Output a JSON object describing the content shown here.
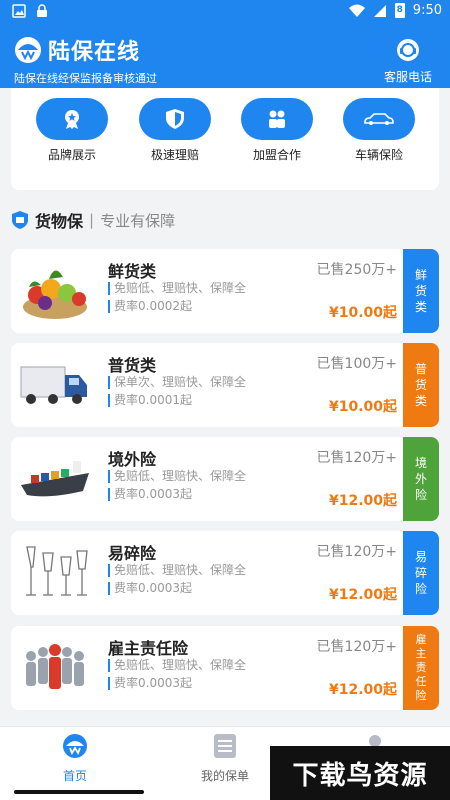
{
  "status": {
    "time": "9:50",
    "battery": "8"
  },
  "header": {
    "title": "陆保在线",
    "subtitle": "陆保在线经保监报备审核通过",
    "service_label": "客服电话"
  },
  "quick_actions": [
    {
      "label": "品牌展示",
      "icon": "medal-icon"
    },
    {
      "label": "极速理赔",
      "icon": "shield-icon"
    },
    {
      "label": "加盟合作",
      "icon": "people-icon"
    },
    {
      "label": "车辆保险",
      "icon": "car-icon"
    }
  ],
  "section": {
    "title": "货物保",
    "separator": "|",
    "subtitle": "专业有保障"
  },
  "products": [
    {
      "name": "鲜货类",
      "features": "免赔低、理赔快、保障全",
      "rate": "费率0.0002起",
      "sold": "已售250万+",
      "price": "¥10.00起",
      "tag_chars": [
        "鲜",
        "货",
        "类"
      ],
      "tag_color": "#1f86f0",
      "image": "fruit-basket-image"
    },
    {
      "name": "普货类",
      "features": "保单次、理赔快、保障全",
      "rate": "费率0.0001起",
      "sold": "已售100万+",
      "price": "¥10.00起",
      "tag_chars": [
        "普",
        "货",
        "类"
      ],
      "tag_color": "#f07a12",
      "image": "truck-image"
    },
    {
      "name": "境外险",
      "features": "免赔低、理赔快、保障全",
      "rate": "费率0.0003起",
      "sold": "已售120万+",
      "price": "¥12.00起",
      "tag_chars": [
        "境",
        "外",
        "险"
      ],
      "tag_color": "#4ea43a",
      "image": "cargo-ship-image"
    },
    {
      "name": "易碎险",
      "features": "免赔低、理赔快、保障全",
      "rate": "费率0.0003起",
      "sold": "已售120万+",
      "price": "¥12.00起",
      "tag_chars": [
        "易",
        "碎",
        "险"
      ],
      "tag_color": "#1f86f0",
      "image": "glassware-image"
    },
    {
      "name": "雇主责任险",
      "features": "免赔低、理赔快、保障全",
      "rate": "费率0.0003起",
      "sold": "已售120万+",
      "price": "¥12.00起",
      "tag_chars": [
        "雇",
        "主",
        "责",
        "任",
        "险"
      ],
      "tag_color": "#f07a12",
      "image": "team-people-image"
    }
  ],
  "tabbar": {
    "home_label": "首页",
    "policy_label": "我的保单"
  },
  "watermark": "下载鸟资源",
  "colors": {
    "primary": "#1f86f0",
    "accent": "#f07a12",
    "green": "#4ea43a"
  }
}
